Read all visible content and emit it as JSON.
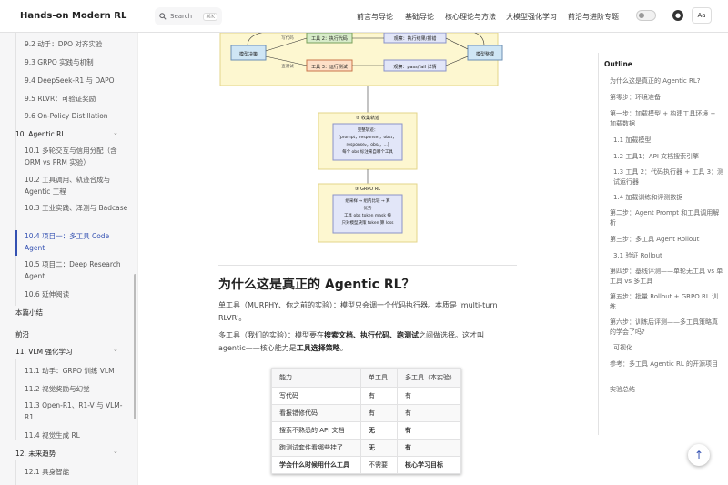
{
  "header": {
    "title": "Hands-on Modern RL",
    "search_label": "Search",
    "search_kbd": "⌘K",
    "nav": [
      "前言与导论",
      "基础导论",
      "核心理论与方法",
      "大模型强化学习",
      "前沿与进阶专题"
    ],
    "theme_label": "Aa"
  },
  "sidebar": {
    "items": [
      "9.2 动手：DPO 对齐实验",
      "9.3 GRPO 实践与机制",
      "9.4 DeepSeek-R1 与 DAPO",
      "9.5 RLVR：可验证奖励",
      "9.6 On-Policy Distillation",
      "10. Agentic RL",
      "10.1 多轮交互与信用分配（含 ORM vs PRM 实验）",
      "10.2 工具调用、轨迹合成与 Agentic 工程",
      "10.3 工业实践、泽测与 Badcase",
      "10.4 项目一：多工具 Code Agent",
      "10.5 项目二：Deep Research Agent",
      "10.6 延伸阅读",
      "本篇小结",
      "前沿",
      "11. VLM 强化学习",
      "11.1 动手：GRPO 训练 VLM",
      "11.2 视觉奖励与幻觉",
      "11.3 Open-R1、R1-V 与 VLM-R1",
      "11.4 视觉生成 RL",
      "12. 未来趋势",
      "12.1 具身智能"
    ]
  },
  "diagram": {
    "top": {
      "label_a": "写代码",
      "label_b": "查测试",
      "tool2": "工具 2：执行代码",
      "tool3": "工具 3：运行测试",
      "obs1": "观察：执行结果/报错",
      "obs2": "观察：pass/fail 详情",
      "left_box": "模型决策",
      "right_box": "模型整理"
    },
    "mid": {
      "title": "② 收集轨迹",
      "l1": "完整轨迹：",
      "l2": "[prompt，response₁，obs₁，",
      "l3": "response₂，obs₂，...]",
      "l4": "每个 obs 标注来自哪个工具"
    },
    "bot": {
      "title": "③ GRPO RL",
      "l1": "组采样 → 组内比较 → 算",
      "l2": "优势",
      "l3": "工具 obs token mask 掉",
      "l4": "只对模型决策 token 算 loss"
    }
  },
  "main": {
    "heading": "为什么这是真正的 Agentic RL？",
    "p1a": "单工具（MURPHY、你之前的实验）：模型只会调一个代码执行器。本质是 'multi-turn",
    "p1b": "RLVR'。",
    "p2a_1": "多工具（我们的实验）：模型要在",
    "p2a_b": "搜索文档、执行代码、跑测试",
    "p2a_2": "之间做选择。这才叫",
    "p2b_1": "agentic——核心能力是",
    "p2b_b": "工具选择策略",
    "p2b_2": "。",
    "table": {
      "headers": [
        "能力",
        "单工具",
        "多工具（本实验）"
      ],
      "rows": [
        [
          "写代码",
          "有",
          "有"
        ],
        [
          "看报错修代码",
          "有",
          "有"
        ],
        [
          "搜索不熟悉的 API 文档",
          "无",
          "有"
        ],
        [
          "跑测试套件看哪些挂了",
          "无",
          "有"
        ],
        [
          "学会什么时候用什么工具",
          "不需要",
          "核心学习目标"
        ]
      ]
    }
  },
  "outline": {
    "title": "Outline",
    "items": [
      "为什么这是真正的 Agentic RL?",
      "第零步：环境准备",
      "第一步：加载模型 + 构建工具环境 + 加载数据",
      "1.1 加载模型",
      "1.2 工具1：API 文档搜索引擎",
      "1.3 工具 2：代码执行器 + 工具 3：测试运行器",
      "1.4 加载训练和评测数据",
      "第二步：Agent Prompt 和工具调用解析",
      "第三步：多工具 Agent Rollout",
      "3.1 验证 Rollout",
      "第四步：基线评测——单轮无工具 vs 单工具 vs 多工具",
      "第五步：批量 Rollout + GRPO RL 训练",
      "第六步：训练后评测——多工具策略真的学会了吗?",
      "可视化",
      "参考：多工具 Agentic RL 的开源项目",
      "实验总结"
    ]
  },
  "fab": "↑"
}
